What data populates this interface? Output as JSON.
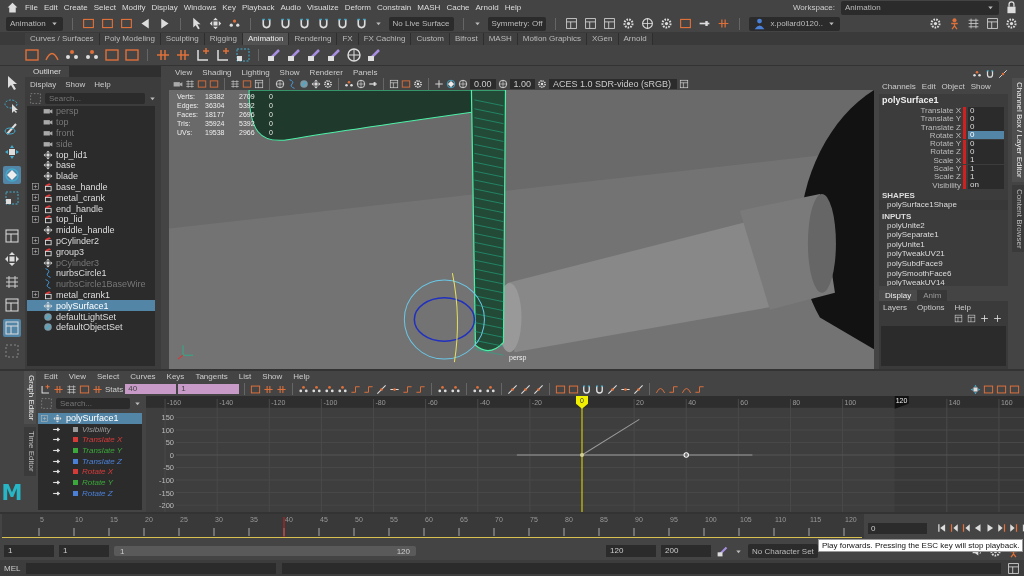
{
  "menu_bar": [
    "File",
    "Edit",
    "Create",
    "Select",
    "Modify",
    "Display",
    "Windows",
    "Key",
    "Playback",
    "Audio",
    "Visualize",
    "Deform",
    "Constrain",
    "MASH",
    "Cache",
    "Arnold",
    "Help"
  ],
  "workspace": {
    "label": "Workspace:",
    "value": "Animation"
  },
  "status_line": {
    "menu_set": "Animation",
    "live_surface": "No Live Surface",
    "symmetry": "Symmetry: Off",
    "user": "x.pollard0120.."
  },
  "shelf_tabs": [
    {
      "label": "Curves / Surfaces",
      "selected": false
    },
    {
      "label": "Poly Modeling",
      "selected": false
    },
    {
      "label": "Sculpting",
      "selected": false
    },
    {
      "label": "Rigging",
      "selected": false
    },
    {
      "label": "Animation",
      "selected": true
    },
    {
      "label": "Rendering",
      "selected": false
    },
    {
      "label": "FX",
      "selected": false
    },
    {
      "label": "FX Caching",
      "selected": false
    },
    {
      "label": "Custom",
      "selected": false
    },
    {
      "label": "Bifrost",
      "selected": false
    },
    {
      "label": "MASH",
      "selected": false
    },
    {
      "label": "Motion Graphics",
      "selected": false
    },
    {
      "label": "XGen",
      "selected": false
    },
    {
      "label": "Arnold",
      "selected": false
    }
  ],
  "outliner": {
    "title": "Outliner",
    "menu": [
      "Display",
      "Show",
      "Help"
    ],
    "search_placeholder": "Search...",
    "items": [
      {
        "name": "persp",
        "kind": "camera",
        "dimmed": true,
        "expandable": false,
        "selected": false
      },
      {
        "name": "top",
        "kind": "camera",
        "dimmed": true,
        "expandable": false,
        "selected": false
      },
      {
        "name": "front",
        "kind": "camera",
        "dimmed": true,
        "expandable": false,
        "selected": false
      },
      {
        "name": "side",
        "kind": "camera",
        "dimmed": true,
        "expandable": false,
        "selected": false
      },
      {
        "name": "top_lid1",
        "kind": "transform",
        "dimmed": false,
        "expandable": false,
        "selected": false
      },
      {
        "name": "base",
        "kind": "transform",
        "dimmed": false,
        "expandable": false,
        "selected": false
      },
      {
        "name": "blade",
        "kind": "transform",
        "dimmed": false,
        "expandable": false,
        "selected": false
      },
      {
        "name": "base_handle",
        "kind": "group",
        "dimmed": false,
        "expandable": true,
        "selected": false
      },
      {
        "name": "metal_crank",
        "kind": "group",
        "dimmed": false,
        "expandable": true,
        "selected": false
      },
      {
        "name": "end_handle",
        "kind": "group",
        "dimmed": false,
        "expandable": true,
        "selected": false
      },
      {
        "name": "top_lid",
        "kind": "group",
        "dimmed": false,
        "expandable": true,
        "selected": false
      },
      {
        "name": "middle_handle",
        "kind": "transform",
        "dimmed": false,
        "expandable": false,
        "selected": false
      },
      {
        "name": "pCylinder2",
        "kind": "group",
        "dimmed": false,
        "expandable": true,
        "selected": false
      },
      {
        "name": "group3",
        "kind": "group",
        "dimmed": false,
        "expandable": true,
        "selected": false
      },
      {
        "name": "pCylinder3",
        "kind": "transform",
        "dimmed": true,
        "expandable": false,
        "selected": false
      },
      {
        "name": "nurbsCircle1",
        "kind": "curve",
        "dimmed": false,
        "expandable": false,
        "selected": false
      },
      {
        "name": "nurbsCircle1BaseWire",
        "kind": "curve",
        "dimmed": true,
        "expandable": false,
        "selected": false
      },
      {
        "name": "metal_crank1",
        "kind": "group",
        "dimmed": false,
        "expandable": true,
        "selected": false
      },
      {
        "name": "polySurface1",
        "kind": "transform",
        "dimmed": false,
        "expandable": false,
        "selected": true
      },
      {
        "name": "defaultLightSet",
        "kind": "set",
        "dimmed": false,
        "expandable": false,
        "selected": false
      },
      {
        "name": "defaultObjectSet",
        "kind": "set",
        "dimmed": false,
        "expandable": false,
        "selected": false
      }
    ]
  },
  "viewport": {
    "menu": [
      "View",
      "Shading",
      "Lighting",
      "Show",
      "Renderer",
      "Panels"
    ],
    "exposure": "0.00",
    "gamma": "1.00",
    "color_space": "ACES 1.0 SDR-video (sRGB)",
    "hud": [
      {
        "label": "Verts:",
        "values": [
          "18382",
          "2709",
          "0"
        ]
      },
      {
        "label": "Edges:",
        "values": [
          "36304",
          "5392",
          "0"
        ]
      },
      {
        "label": "Faces:",
        "values": [
          "18177",
          "2696",
          "0"
        ]
      },
      {
        "label": "Tris:",
        "values": [
          "35924",
          "5392",
          "0"
        ]
      },
      {
        "label": "UVs:",
        "values": [
          "19538",
          "2966",
          "0"
        ]
      }
    ],
    "camera_label": "persp"
  },
  "channel_box": {
    "menu": [
      "Channels",
      "Edit",
      "Object",
      "Show"
    ],
    "object": "polySurface1",
    "channels": [
      {
        "name": "Translate X",
        "value": "0",
        "keyed": true,
        "selected": false
      },
      {
        "name": "Translate Y",
        "value": "0",
        "keyed": true,
        "selected": false
      },
      {
        "name": "Translate Z",
        "value": "0",
        "keyed": true,
        "selected": false
      },
      {
        "name": "Rotate X",
        "value": "0",
        "keyed": true,
        "selected": true
      },
      {
        "name": "Rotate Y",
        "value": "0",
        "keyed": true,
        "selected": false
      },
      {
        "name": "Rotate Z",
        "value": "0",
        "keyed": true,
        "selected": false
      },
      {
        "name": "Scale X",
        "value": "1",
        "keyed": true,
        "selected": false
      },
      {
        "name": "Scale Y",
        "value": "1",
        "keyed": true,
        "selected": false
      },
      {
        "name": "Scale Z",
        "value": "1",
        "keyed": true,
        "selected": false
      },
      {
        "name": "Visibility",
        "value": "on",
        "keyed": true,
        "selected": false
      }
    ],
    "shapes_header": "SHAPES",
    "shapes": [
      "polySurface1Shape"
    ],
    "inputs_header": "INPUTS",
    "inputs": [
      "polyUnite2",
      "polySeparate1",
      "polyUnite1",
      "polyTweakUV21",
      "polySubdFace9",
      "polySmoothFace6",
      "polyTweakUV14"
    ],
    "layer_tabs": [
      {
        "label": "Display",
        "selected": true
      },
      {
        "label": "Anim",
        "selected": false
      }
    ],
    "layer_menu": [
      "Layers",
      "Options",
      "Help"
    ]
  },
  "side_tabs": [
    "Channel Box / Layer Editor",
    "Content Browser"
  ],
  "logo": "M",
  "graph_editor": {
    "side_tabs": [
      {
        "label": "Graph Editor",
        "selected": true
      },
      {
        "label": "Time Editor",
        "selected": false
      }
    ],
    "menu": [
      "Edit",
      "View",
      "Select",
      "Curves",
      "Keys",
      "Tangents",
      "List",
      "Show",
      "Help"
    ],
    "stats_label": "Stats",
    "stats_values": [
      "40",
      "1"
    ],
    "search_placeholder": "Search...",
    "object": {
      "name": "polySurface1",
      "selected": true
    },
    "curves": [
      {
        "name": "Visibility",
        "color": "#9a9a9a",
        "selected": false
      },
      {
        "name": "Translate X",
        "color": "#d83a3a",
        "selected": false
      },
      {
        "name": "Translate Y",
        "color": "#3aa83a",
        "selected": false
      },
      {
        "name": "Translate Z",
        "color": "#4a80d8",
        "selected": false
      },
      {
        "name": "Rotate X",
        "color": "#d83a3a",
        "selected": false
      },
      {
        "name": "Rotate Y",
        "color": "#3aa83a",
        "selected": false
      },
      {
        "name": "Rotate Z",
        "color": "#4a80d8",
        "selected": false
      }
    ],
    "x_labels": [
      "-160",
      "-140",
      "-120",
      "-100",
      "-80",
      "-60",
      "-40",
      "-20",
      "20",
      "40",
      "60",
      "80",
      "100",
      "140",
      "160"
    ],
    "y_labels": [
      "150",
      "100",
      "50",
      "0",
      "-50",
      "-100",
      "-150",
      "-200"
    ],
    "current_frame": "0",
    "end_frame": "120"
  },
  "time_slider": {
    "labels": [
      "5",
      "10",
      "15",
      "20",
      "25",
      "30",
      "35",
      "40",
      "45",
      "50",
      "55",
      "60",
      "65",
      "70",
      "75",
      "80",
      "85",
      "90",
      "95",
      "100",
      "105",
      "110",
      "115",
      "120"
    ],
    "current_time": "0"
  },
  "range": {
    "start": "1",
    "playback_start": "1",
    "slider_start": "1",
    "slider_end": "120",
    "playback_end": "120",
    "end": "200",
    "character_set": "No Character Set"
  },
  "tooltip": "Play forwards. Pressing the ESC key will stop playback.",
  "command_line": {
    "label": "MEL"
  }
}
